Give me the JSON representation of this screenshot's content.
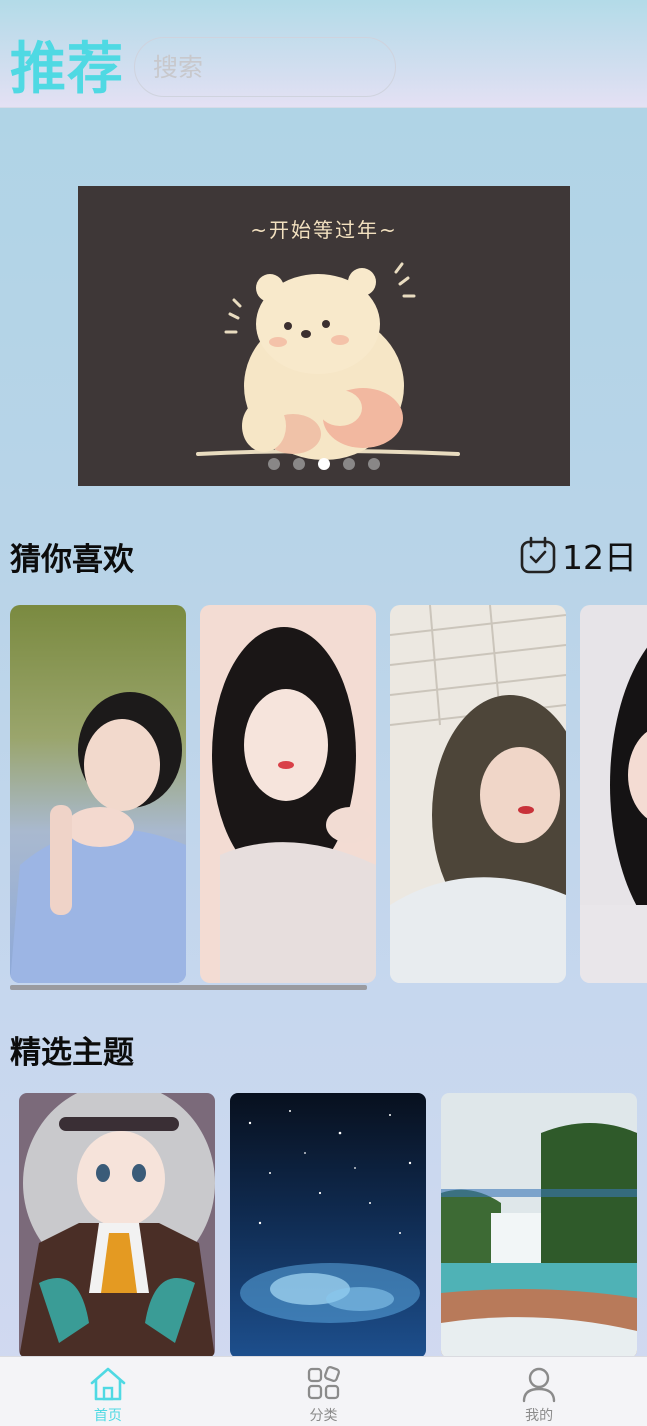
{
  "header": {
    "title": "推荐",
    "search_placeholder": "搜索",
    "title_color": "#4fd9e3"
  },
  "banner": {
    "caption": "~开始等过年~",
    "slide_count": 5,
    "active_slide": 3
  },
  "guess_section": {
    "title": "猜你喜欢",
    "date_icon": "calendar-check-icon",
    "date_text": "12日",
    "cards": [
      {
        "name": "photo-card-1"
      },
      {
        "name": "photo-card-2"
      },
      {
        "name": "photo-card-3"
      },
      {
        "name": "photo-card-4"
      }
    ]
  },
  "theme_section": {
    "title": "精选主题",
    "cards": [
      {
        "name": "theme-card-anime"
      },
      {
        "name": "theme-card-starry-sky"
      },
      {
        "name": "theme-card-waterfall"
      }
    ]
  },
  "tabbar": {
    "active_color": "#4fd9e3",
    "tabs": [
      {
        "label": "首页",
        "icon": "home-icon",
        "active": true
      },
      {
        "label": "分类",
        "icon": "category-grid-icon",
        "active": false
      },
      {
        "label": "我的",
        "icon": "user-profile-icon",
        "active": false
      }
    ]
  }
}
